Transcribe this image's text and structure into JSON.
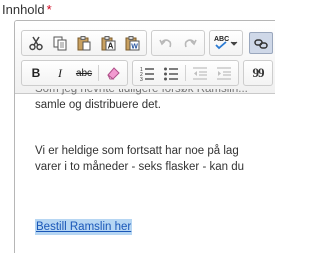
{
  "field": {
    "label": "Innhold",
    "required_mark": "*"
  },
  "toolbar": {
    "row1": [
      "cut-icon",
      "copy-icon",
      "paste-icon",
      "paste-text-icon",
      "paste-word-icon",
      "undo-icon",
      "redo-icon",
      "spellcheck-icon",
      "link-icon"
    ],
    "row2": [
      "bold-icon",
      "italic-icon",
      "strikethrough-icon",
      "remove-format-icon",
      "numbered-list-icon",
      "bulleted-list-icon",
      "outdent-icon",
      "indent-icon",
      "blockquote-icon"
    ],
    "spellcheck_label": "ABC",
    "bold": "B",
    "italic": "I",
    "strike": "abc",
    "quote": "99"
  },
  "content": {
    "line_partial": "Som jeg hevnte tidligere forsøk Ramslin...",
    "line1": "samle og distribuere det.",
    "line2": "Vi er heldige som fortsatt har noe på lag",
    "line3": "varer i to måneder - seks flasker - kan du",
    "link": "Bestill Ramslin her"
  }
}
